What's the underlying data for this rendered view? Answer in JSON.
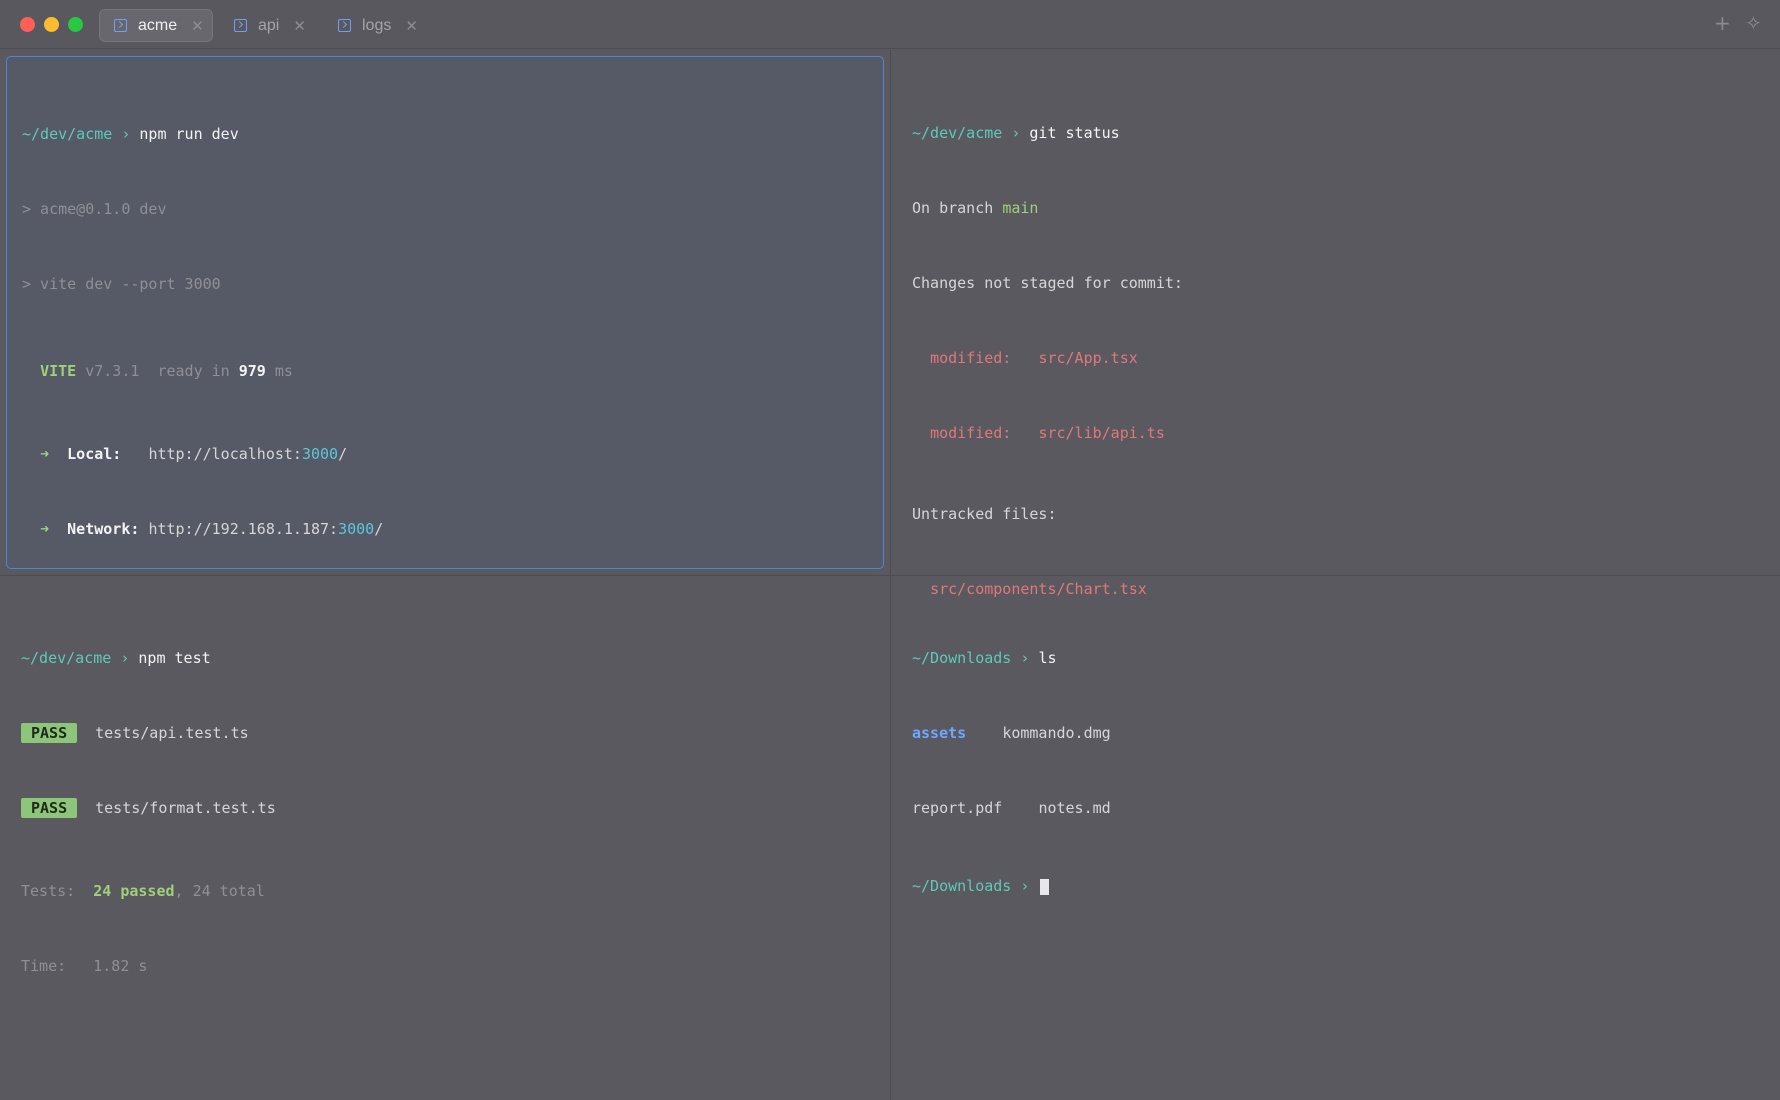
{
  "tabs": [
    {
      "label": "acme",
      "active": true
    },
    {
      "label": "api",
      "active": false
    },
    {
      "label": "logs",
      "active": false
    }
  ],
  "titlebar": {
    "new_tab": "+",
    "spark": "✧"
  },
  "pane_dev": {
    "path": "~/dev/acme",
    "command": "npm run dev",
    "out1": "> acme@0.1.0 dev",
    "out2": "> vite dev --port 3000",
    "vite": "VITE",
    "version": "v7.3.1",
    "ready": "ready in",
    "ms_value": "979",
    "ms": "ms",
    "arrow": "➜",
    "local_label": "Local:",
    "local_url": "http://localhost:",
    "local_port": "3000",
    "local_slash": "/",
    "network_label": "Network:",
    "network_url": "http://192.168.1.187:",
    "network_port": "3000",
    "network_slash": "/"
  },
  "pane_git": {
    "path": "~/dev/acme",
    "command": "git status",
    "branch_prefix": "On branch",
    "branch": "main",
    "changes_header": "Changes not staged for commit:",
    "modified": [
      {
        "status": "modified:",
        "file": "src/App.tsx"
      },
      {
        "status": "modified:",
        "file": "src/lib/api.ts"
      }
    ],
    "untracked_header": "Untracked files:",
    "untracked": [
      "src/components/Chart.tsx"
    ]
  },
  "pane_test": {
    "path": "~/dev/acme",
    "command": "npm test",
    "results": [
      {
        "badge": "PASS",
        "file": "tests/api.test.ts"
      },
      {
        "badge": "PASS",
        "file": "tests/format.test.ts"
      }
    ],
    "tests_label": "Tests:",
    "tests_passed": "24 passed",
    "tests_total": ", 24 total",
    "time_label": "Time:",
    "time_value": "1.82 s"
  },
  "pane_ls": {
    "path": "~/Downloads",
    "command": "ls",
    "entries_row1": [
      "assets",
      "kommando.dmg"
    ],
    "entries_row2": [
      "report.pdf",
      "notes.md"
    ],
    "prompt_path": "~/Downloads"
  },
  "prompt_char": "›"
}
